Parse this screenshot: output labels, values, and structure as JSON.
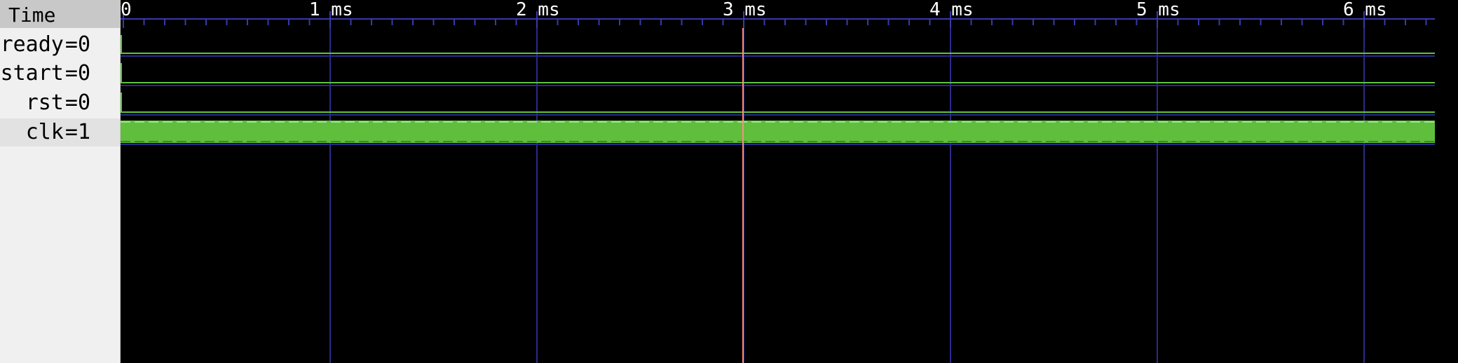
{
  "window": {
    "time_header": "Time",
    "time_unit": "ms"
  },
  "signals": [
    {
      "name": "ready",
      "value": "0"
    },
    {
      "name": "start",
      "value": "0"
    },
    {
      "name": "rst",
      "value": "0"
    },
    {
      "name": "clk",
      "value": "1"
    }
  ],
  "timeline": {
    "labels": [
      "0",
      "1 ms",
      "2 ms",
      "3 ms",
      "4 ms",
      "5 ms",
      "6 ms"
    ],
    "cursor_time_ms": 3
  },
  "colors": {
    "background": "#000000",
    "grid": "#2a2a8a",
    "signal": "#5fc440",
    "clock_fill": "#5fbe3c",
    "cursor": "#ff8a80",
    "panel": "#f0f0f0",
    "header": "#c8c8c8"
  }
}
